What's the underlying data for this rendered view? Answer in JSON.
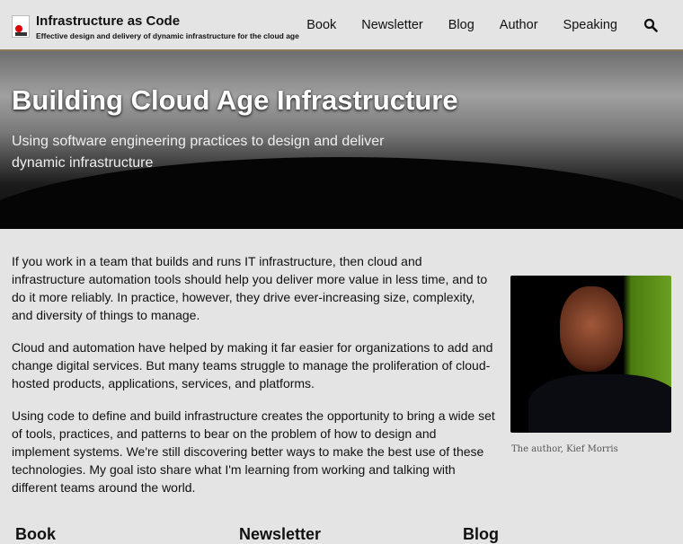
{
  "header": {
    "title": "Infrastructure as Code",
    "tagline": "Effective design and delivery of dynamic infrastructure for the cloud age",
    "nav": [
      "Book",
      "Newsletter",
      "Blog",
      "Author",
      "Speaking"
    ]
  },
  "hero": {
    "title": "Building Cloud Age Infrastructure",
    "subtitle": "Using software engineering practices to design and deliver dynamic infrastructure"
  },
  "main": {
    "paragraphs": [
      "If you work in a team that builds and runs IT infrastructure, then cloud and infrastructure automation tools should help you deliver more value in less time, and to do it more reliably. In practice, however, they drive ever-increasing size, complexity, and diversity of things to manage.",
      "Cloud and automation have helped by making it far easier for organizations to add and change digital services. But many teams struggle to manage the proliferation of cloud-hosted products, applications, services, and platforms.",
      "Using code to define and build infrastructure creates the opportunity to bring a wide set of tools, practices, and patterns to bear on the problem of how to design and implement systems. We're still discovering better ways to make the best use of these technologies. My goal isto share what I'm learning from working and talking with different teams around the world."
    ],
    "photo_caption": "The author, Kief Morris"
  },
  "sections": [
    "Book",
    "Newsletter",
    "Blog"
  ]
}
